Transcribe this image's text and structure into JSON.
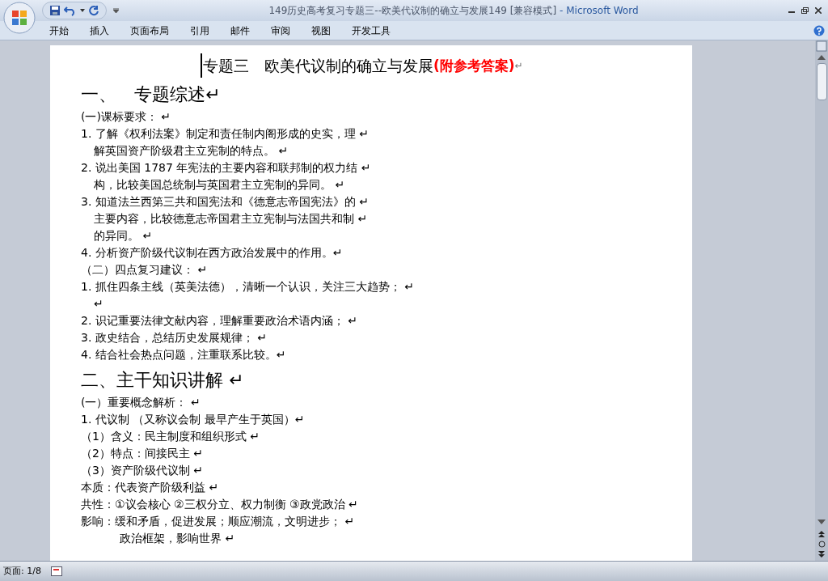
{
  "window": {
    "title": "149历史高考复习专题三--欧美代议制的确立与发展149 [兼容模式]",
    "app": "- Microsoft Word"
  },
  "tabs": [
    {
      "label": "开始",
      "selected": false
    },
    {
      "label": "插入",
      "selected": false
    },
    {
      "label": "页面布局",
      "selected": false
    },
    {
      "label": "引用",
      "selected": false
    },
    {
      "label": "邮件",
      "selected": false
    },
    {
      "label": "审阅",
      "selected": false
    },
    {
      "label": "视图",
      "selected": false
    },
    {
      "label": "开发工具",
      "selected": false
    }
  ],
  "document": {
    "title": {
      "text": "专题三　欧美代议制的确立与发展",
      "note": "(附参考答案)",
      "mark": "↵"
    },
    "lines": [
      {
        "kind": "heading",
        "text": "一、　专题综述↵"
      },
      {
        "kind": "text",
        "text": "(一)课标要求： ↵"
      },
      {
        "kind": "text",
        "text": "1. 了解《权利法案》制定和责任制内阁形成的史实，理 ↵"
      },
      {
        "kind": "wrap",
        "text": "解英国资产阶级君主立宪制的特点。 ↵"
      },
      {
        "kind": "text",
        "text": "2. 说出美国 1787 年宪法的主要内容和联邦制的权力结 ↵"
      },
      {
        "kind": "wrap",
        "text": "构，比较美国总统制与英国君主立宪制的异同。 ↵"
      },
      {
        "kind": "text",
        "text": "3. 知道法兰西第三共和国宪法和《德意志帝国宪法》的 ↵"
      },
      {
        "kind": "wrap",
        "text": "主要内容，比较德意志帝国君主立宪制与法国共和制 ↵"
      },
      {
        "kind": "wrap",
        "text": "的异同。 ↵"
      },
      {
        "kind": "text",
        "text": "4. 分析资产阶级代议制在西方政治发展中的作用。↵"
      },
      {
        "kind": "text",
        "text": "（二）四点复习建议： ↵"
      },
      {
        "kind": "text",
        "text": "1. 抓住四条主线（英美法德），清晰一个认识，关注三大趋势； ↵"
      },
      {
        "kind": "wrap",
        "text": "↵"
      },
      {
        "kind": "text",
        "text": "2. 识记重要法律文献内容，理解重要政治术语内涵； ↵"
      },
      {
        "kind": "text",
        "text": "3. 政史结合，总结历史发展规律； ↵"
      },
      {
        "kind": "text",
        "text": "4. 结合社会热点问题，注重联系比较。↵"
      },
      {
        "kind": "heading",
        "text": "二、主干知识讲解 ↵"
      },
      {
        "kind": "text",
        "text": "(一）重要概念解析： ↵"
      },
      {
        "kind": "text",
        "text": "1. 代议制 （又称议会制 最早产生于英国）↵"
      },
      {
        "kind": "text",
        "text": "（1）含义：民主制度和组织形式 ↵"
      },
      {
        "kind": "text",
        "text": "（2）特点：间接民主 ↵"
      },
      {
        "kind": "text",
        "text": "（3）资产阶级代议制 ↵"
      },
      {
        "kind": "text",
        "text": "本质：代表资产阶级利益 ↵"
      },
      {
        "kind": "text",
        "text": "共性：①议会核心 ②三权分立、权力制衡 ③政党政治 ↵"
      },
      {
        "kind": "text",
        "text": "影响：缓和矛盾，促进发展；顺应潮流，文明进步； ↵"
      },
      {
        "kind": "deep",
        "text": "政治框架，影响世界 ↵"
      }
    ]
  },
  "status_bar": {
    "page": "页面: 1/8"
  }
}
